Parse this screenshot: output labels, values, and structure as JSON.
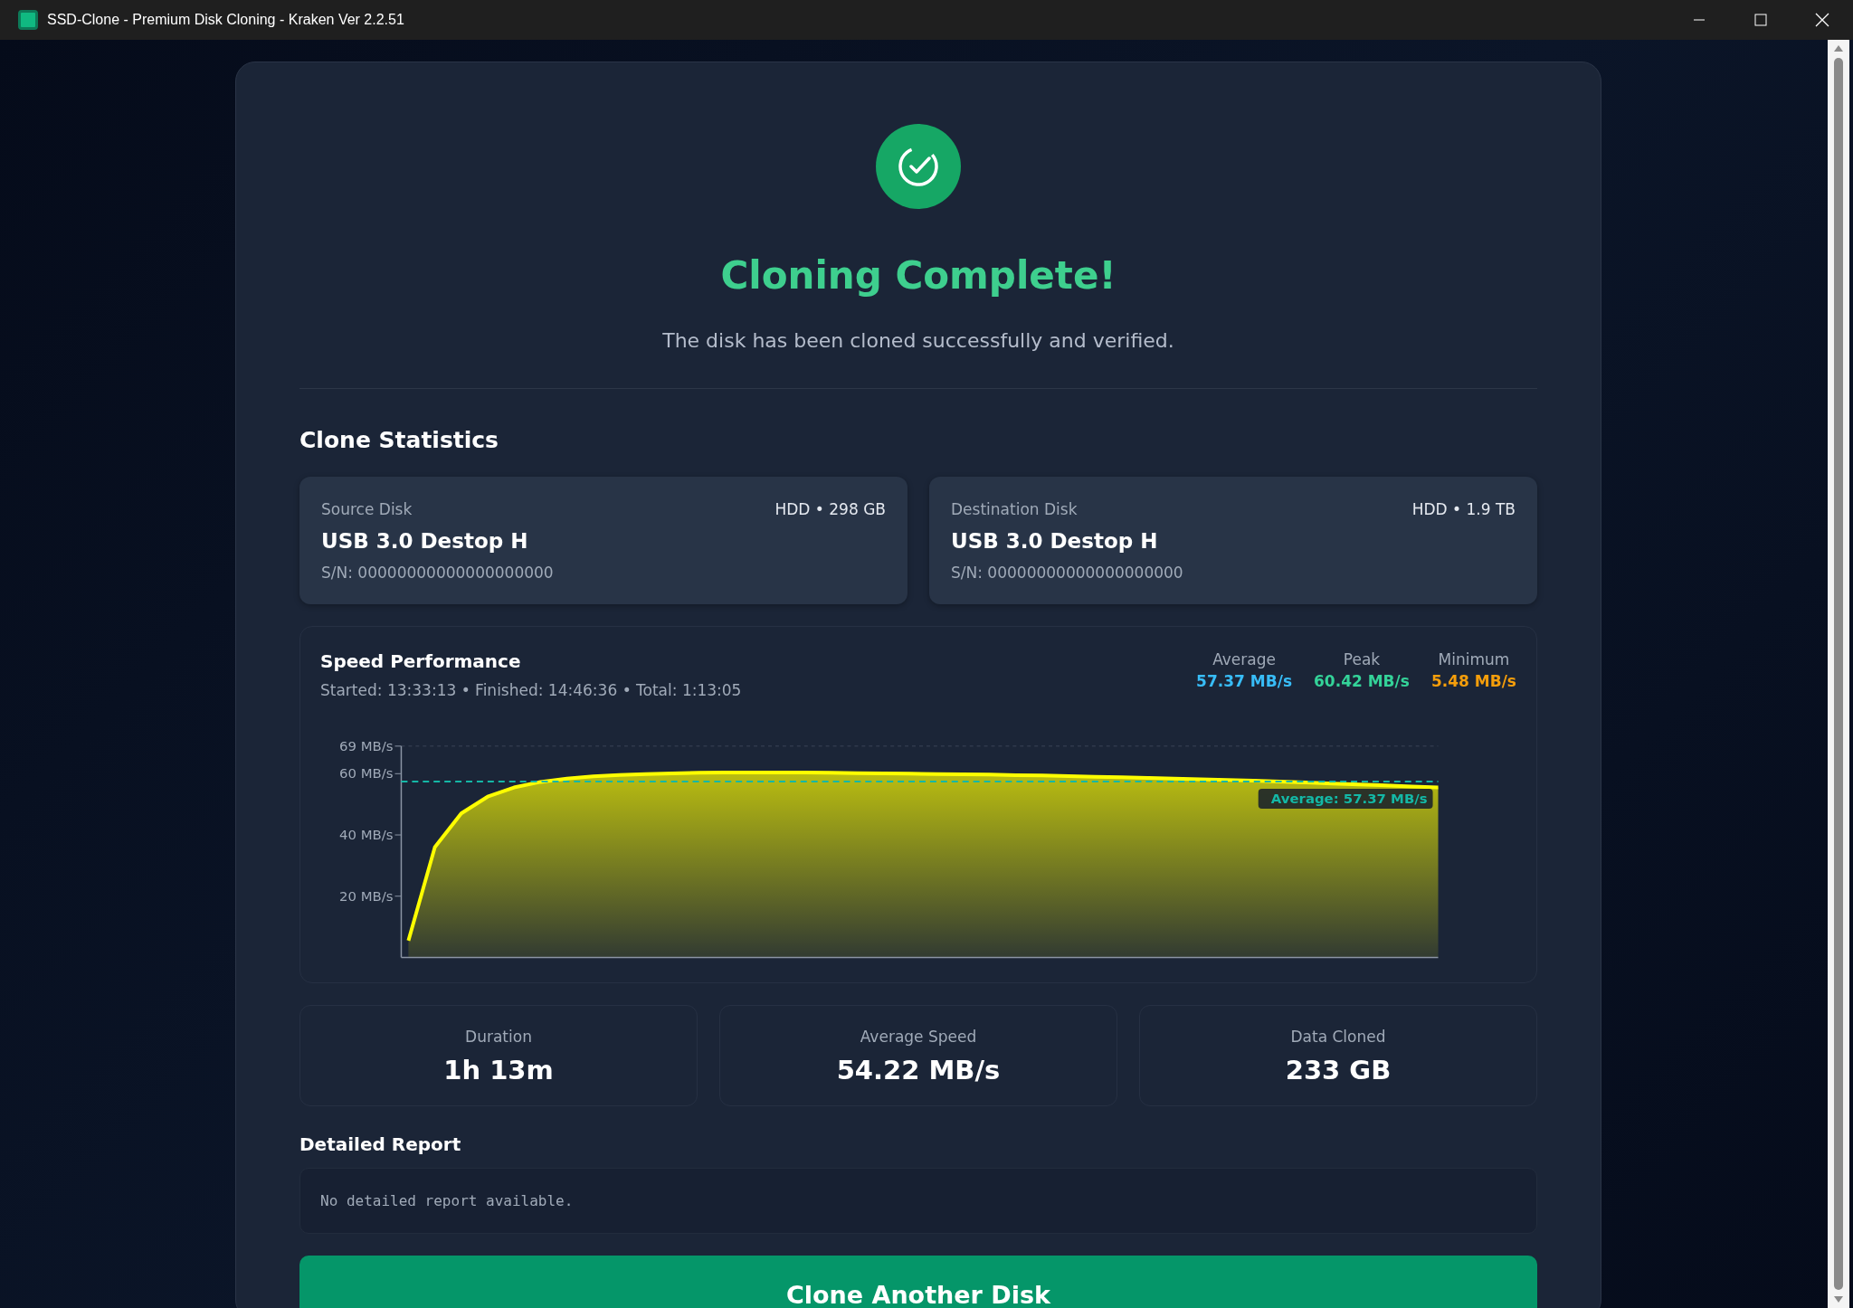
{
  "window": {
    "title": "SSD-Clone - Premium Disk Cloning - Kraken Ver 2.2.51"
  },
  "header": {
    "title": "Cloning Complete!",
    "subtitle": "The disk has been cloned successfully and verified."
  },
  "statistics": {
    "title": "Clone Statistics",
    "disks": [
      {
        "label": "Source Disk",
        "spec": "HDD • 298 GB",
        "name": "USB 3.0 Destop H",
        "serial": "S/N: 00000000000000000000"
      },
      {
        "label": "Destination Disk",
        "spec": "HDD • 1.9 TB",
        "name": "USB 3.0 Destop H",
        "serial": "S/N: 00000000000000000000"
      }
    ]
  },
  "speed": {
    "title": "Speed Performance",
    "times": "Started: 13:33:13 • Finished: 14:46:36 • Total: 1:13:05",
    "summary": [
      {
        "label": "Average",
        "value": "57.37 MB/s",
        "color": "#38bdf8"
      },
      {
        "label": "Peak",
        "value": "60.42 MB/s",
        "color": "#34d399"
      },
      {
        "label": "Minimum",
        "value": "5.48 MB/s",
        "color": "#f59e0b"
      }
    ],
    "chart_data": {
      "type": "area",
      "ylim": [
        0,
        69
      ],
      "yticks": [
        {
          "value": 20,
          "label": "20 MB/s"
        },
        {
          "value": 40,
          "label": "40 MB/s"
        },
        {
          "value": 60,
          "label": "60 MB/s"
        },
        {
          "value": 69,
          "label": "69 MB/s"
        }
      ],
      "series": [
        {
          "color": "#ffff00",
          "values": [
            5.5,
            36,
            47,
            52.5,
            55.5,
            57.3,
            58.4,
            59.1,
            59.6,
            59.9,
            60.1,
            60.3,
            60.4,
            60.4,
            60.4,
            60.4,
            60.3,
            60.2,
            60.1,
            60.0,
            59.9,
            59.8,
            59.7,
            59.5,
            59.4,
            59.2,
            59.0,
            58.8,
            58.6,
            58.4,
            58.2,
            58.0,
            57.7,
            57.4,
            57.1,
            56.8,
            56.5,
            56.2,
            55.8,
            55.5
          ]
        },
        {
          "type": "line",
          "line_style": "dashed",
          "color": "#14b8a6",
          "values": [
            57.4,
            57.4,
            57.4,
            57.4,
            57.4,
            57.4,
            57.4,
            57.4,
            57.4,
            57.4,
            57.4,
            57.4,
            57.4,
            57.4,
            57.4,
            57.4,
            57.4,
            57.4,
            57.4,
            57.4,
            57.4,
            57.4,
            57.4,
            57.4,
            57.4,
            57.4,
            57.4,
            57.4,
            57.4,
            57.4,
            57.4,
            57.4,
            57.4,
            57.4,
            57.4,
            57.4,
            57.4,
            57.4,
            57.4,
            57.4
          ]
        }
      ],
      "annotations": [
        "Average: 57.37 MB/s"
      ]
    }
  },
  "totals": [
    {
      "label": "Duration",
      "value": "1h 13m"
    },
    {
      "label": "Average Speed",
      "value": "54.22 MB/s"
    },
    {
      "label": "Data Cloned",
      "value": "233 GB"
    }
  ],
  "report": {
    "title": "Detailed Report",
    "text": "No detailed report available."
  },
  "action": {
    "label": "Clone Another Disk"
  }
}
